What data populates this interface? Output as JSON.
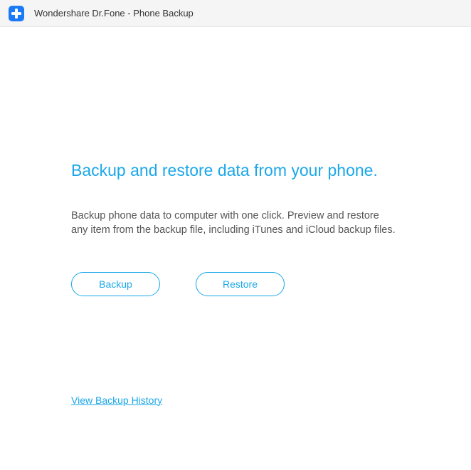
{
  "titleBar": {
    "appTitle": "Wondershare Dr.Fone - Phone Backup"
  },
  "main": {
    "headline": "Backup and restore data from your phone.",
    "description": "Backup phone data to computer with one click. Preview and restore any item from the backup file, including iTunes and iCloud backup files.",
    "backupButton": "Backup",
    "restoreButton": "Restore",
    "historyLink": "View Backup History"
  }
}
